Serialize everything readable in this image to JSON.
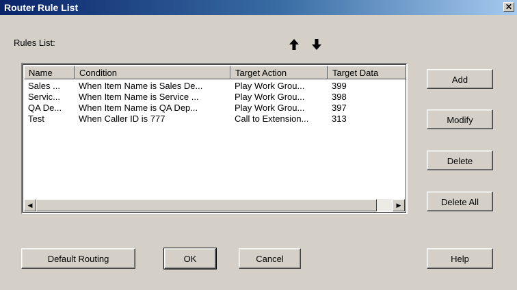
{
  "window": {
    "title": "Router Rule List",
    "close_glyph": "✕"
  },
  "rules_label": "Rules List:",
  "move_up_icon": "arrow-up-icon",
  "move_down_icon": "arrow-down-icon",
  "table": {
    "columns": [
      "Name",
      "Condition",
      "Target Action",
      "Target Data"
    ],
    "rows": [
      [
        "Sales ...",
        "When Item Name is Sales De...",
        "Play Work Grou...",
        "399"
      ],
      [
        "Servic...",
        "When Item Name is Service ...",
        "Play Work Grou...",
        "398"
      ],
      [
        "QA De...",
        "When Item Name is QA Dep...",
        "Play Work Grou...",
        "397"
      ],
      [
        "Test",
        "When Caller ID is 777",
        "Call to Extension...",
        "313"
      ]
    ]
  },
  "scrollbar": {
    "left_glyph": "◀",
    "right_glyph": "▶"
  },
  "buttons": {
    "add": "Add",
    "modify": "Modify",
    "delete": "Delete",
    "delete_all": "Delete All",
    "default_routing": "Default Routing",
    "ok": "OK",
    "cancel": "Cancel",
    "help": "Help"
  },
  "colors": {
    "dialog_bg": "#d4d0c8",
    "titlebar_start": "#0a246a",
    "titlebar_end": "#a6caf0"
  }
}
